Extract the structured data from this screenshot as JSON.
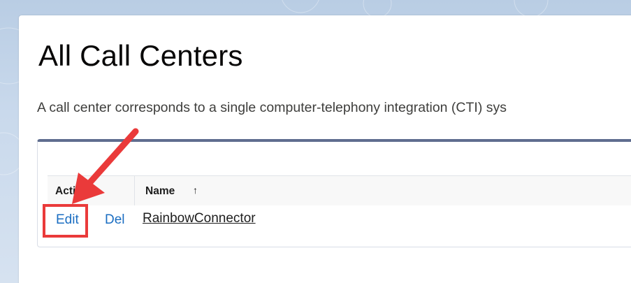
{
  "page": {
    "title": "All Call Centers",
    "description": "A call center corresponds to a single computer-telephony integration (CTI) sys"
  },
  "table": {
    "columns": [
      {
        "label": "Action"
      },
      {
        "label": "Name",
        "sort_icon": "↑"
      }
    ],
    "rows": [
      {
        "edit_label": "Edit",
        "del_label": "Del",
        "name": "RainbowConnector"
      }
    ]
  },
  "annotation": {
    "color": "#ea3a3a",
    "icon": "red-arrow-icon"
  }
}
